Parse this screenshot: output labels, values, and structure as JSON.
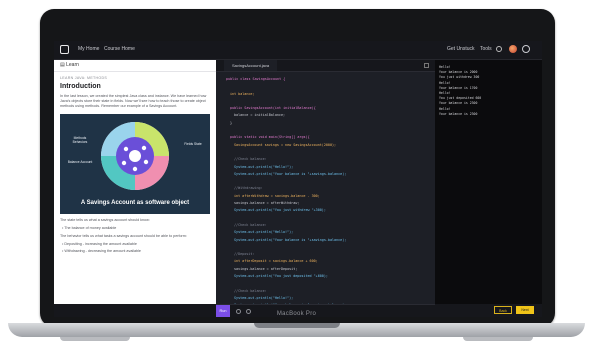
{
  "device": {
    "brand": "MacBook Pro"
  },
  "topbar": {
    "nav": [
      "My Home",
      "Course Home"
    ],
    "right_link": "Get Unstuck",
    "right_tools": "Tools"
  },
  "lesson": {
    "panel_label": "Learn",
    "breadcrumb": "LEARN JAVA: METHODS",
    "title": "Introduction",
    "intro": "In the last lesson, we created the simplest Java class and instance. We have learned how Java's objects store their state in fields. Now we'll see how to teach those to create object methods using methods. Remember our example of a Savings Account.",
    "figure": {
      "caption": "A Savings Account as software object",
      "left_label": "Methods Behaviors",
      "bottom_left_label": "Balance Account",
      "right_label": "Fields State"
    },
    "para2": "The state tells us what a savings account should know:",
    "bullets1": [
      "The balance of money available"
    ],
    "para3": "The behavior tells us what tasks a savings account should be able to perform:",
    "bullets2": [
      "Depositing - increasing the amount available",
      "Withdrawing - decreasing the amount available"
    ]
  },
  "editor": {
    "tab_label": "SavingsAccount.java",
    "lines": [
      "public class SavingsAccount {",
      "",
      "  int balance;",
      "",
      "  public SavingsAccount(int initialBalance){",
      "    balance = initialBalance;",
      "  }",
      "",
      "  public static void main(String[] args){",
      "    SavingsAccount savings = new SavingsAccount(2000);",
      "",
      "    //Check balance:",
      "    System.out.println(\"Hello!\");",
      "    System.out.println(\"Your balance is \"+savings.balance);",
      "",
      "    //Withdrawing:",
      "    int afterWithdraw = savings.balance - 300;",
      "    savings.balance = afterWithdraw;",
      "    System.out.println(\"You just withdrew \"+300);",
      "",
      "    //Check balance:",
      "    System.out.println(\"Hello!\");",
      "    System.out.println(\"Your balance is \"+savings.balance);",
      "",
      "    //Deposit:",
      "    int afterDeposit = savings.balance + 600;",
      "    savings.balance = afterDeposit;",
      "    System.out.println(\"You just deposited \"+600);",
      "",
      "    //Check balance:",
      "    System.out.println(\"Hello!\");",
      "    System.out.println(\"Your balance is \"+savings.balance);"
    ],
    "run_label": "Run"
  },
  "console": {
    "output": [
      "Hello!",
      "Your balance is 2000",
      "You just withdrew 300",
      "Hello!",
      "Your balance is 1700",
      "Hello!",
      "You just deposited 600",
      "Your balance is 2300",
      "Hello!",
      "Your balance is 2300"
    ]
  },
  "footer": {
    "back_label": "Back",
    "next_label": "Next"
  },
  "colors": {
    "accent_purple": "#7b4ee8",
    "next_yellow": "#f0c419"
  }
}
